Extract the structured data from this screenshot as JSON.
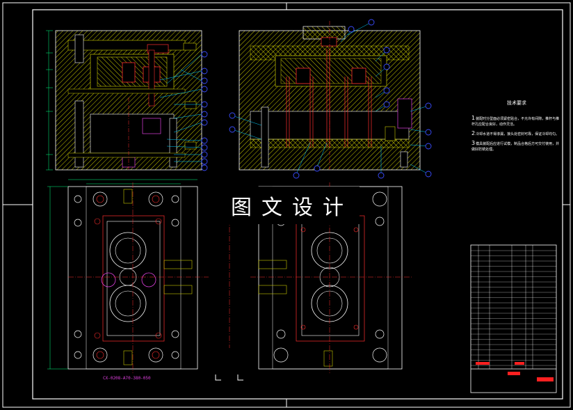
{
  "watermark": "图文设计",
  "technical_requirements": {
    "title": "技术要求",
    "items": [
      {
        "num": "1",
        "text": "装配时分型面必须紧密贴合，不允许有间隙，推杆与推杆孔应配合良好，动作灵活。"
      },
      {
        "num": "2",
        "text": "冷却水道不得渗漏，接头处密封可靠，保证冷却均匀。"
      },
      {
        "num": "3",
        "text": "模具装配后应进行试模，制品合格后方可交付使用，并做好防锈处理。"
      }
    ]
  },
  "drawing_number": "CX-0208-A70-380-050",
  "colors": {
    "background": "#000000",
    "plate_hatch": "#c8c800",
    "outline": "#ffffff",
    "cavity": "#ff2d2d",
    "leader": "#00d0ff",
    "balloon": "#3a4cff",
    "dimension": "#00ff80",
    "title_block_red": "#ff2020",
    "magenta": "#e040e0"
  }
}
